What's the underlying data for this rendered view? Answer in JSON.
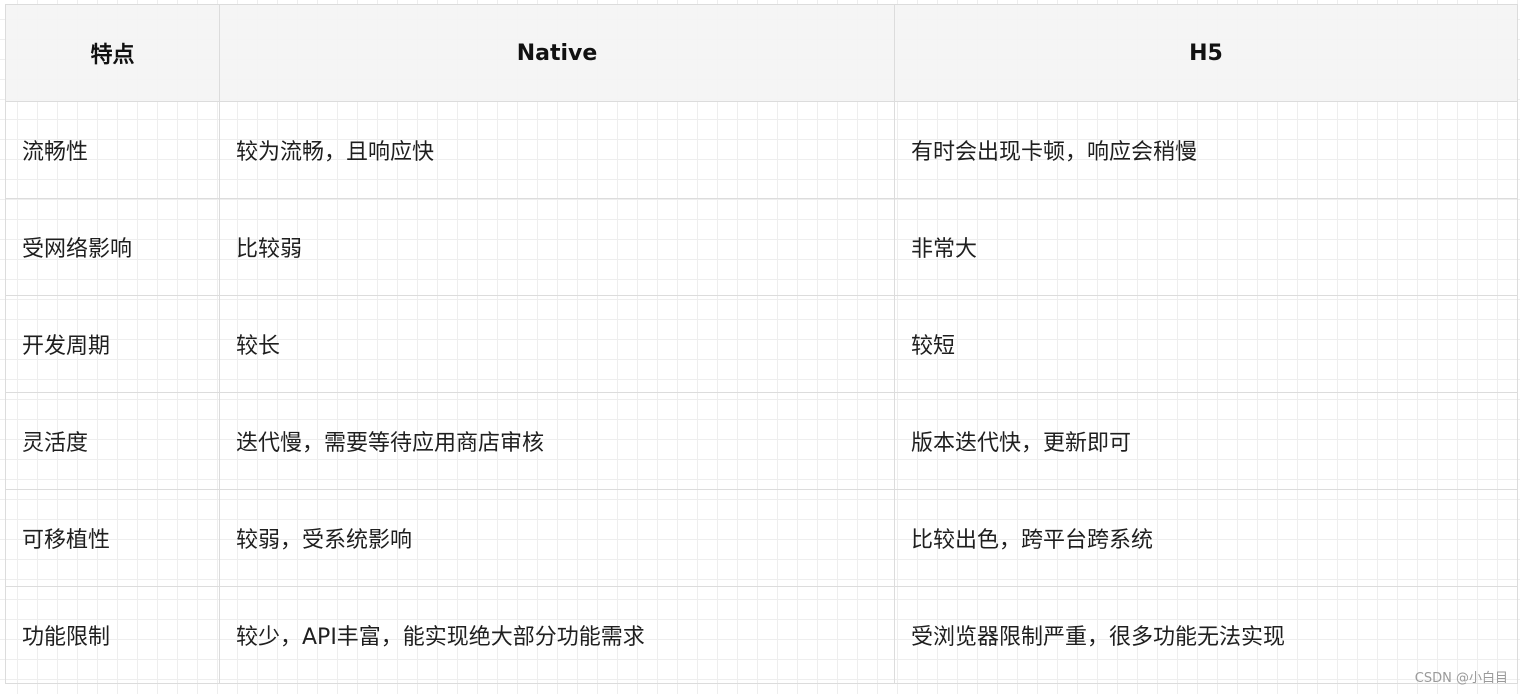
{
  "table": {
    "headers": [
      "特点",
      "Native",
      "H5"
    ],
    "rows": [
      [
        "流畅性",
        "较为流畅，且响应快",
        "有时会出现卡顿，响应会稍慢"
      ],
      [
        "受网络影响",
        "比较弱",
        "非常大"
      ],
      [
        "开发周期",
        "较长",
        "较短"
      ],
      [
        "灵活度",
        "迭代慢，需要等待应用商店审核",
        "版本迭代快，更新即可"
      ],
      [
        "可移植性",
        "较弱，受系统影响",
        "比较出色，跨平台跨系统"
      ],
      [
        "功能限制",
        "较少，API丰富，能实现绝大部分功能需求",
        "受浏览器限制严重，很多功能无法实现"
      ]
    ]
  },
  "watermark": "CSDN @小白目"
}
